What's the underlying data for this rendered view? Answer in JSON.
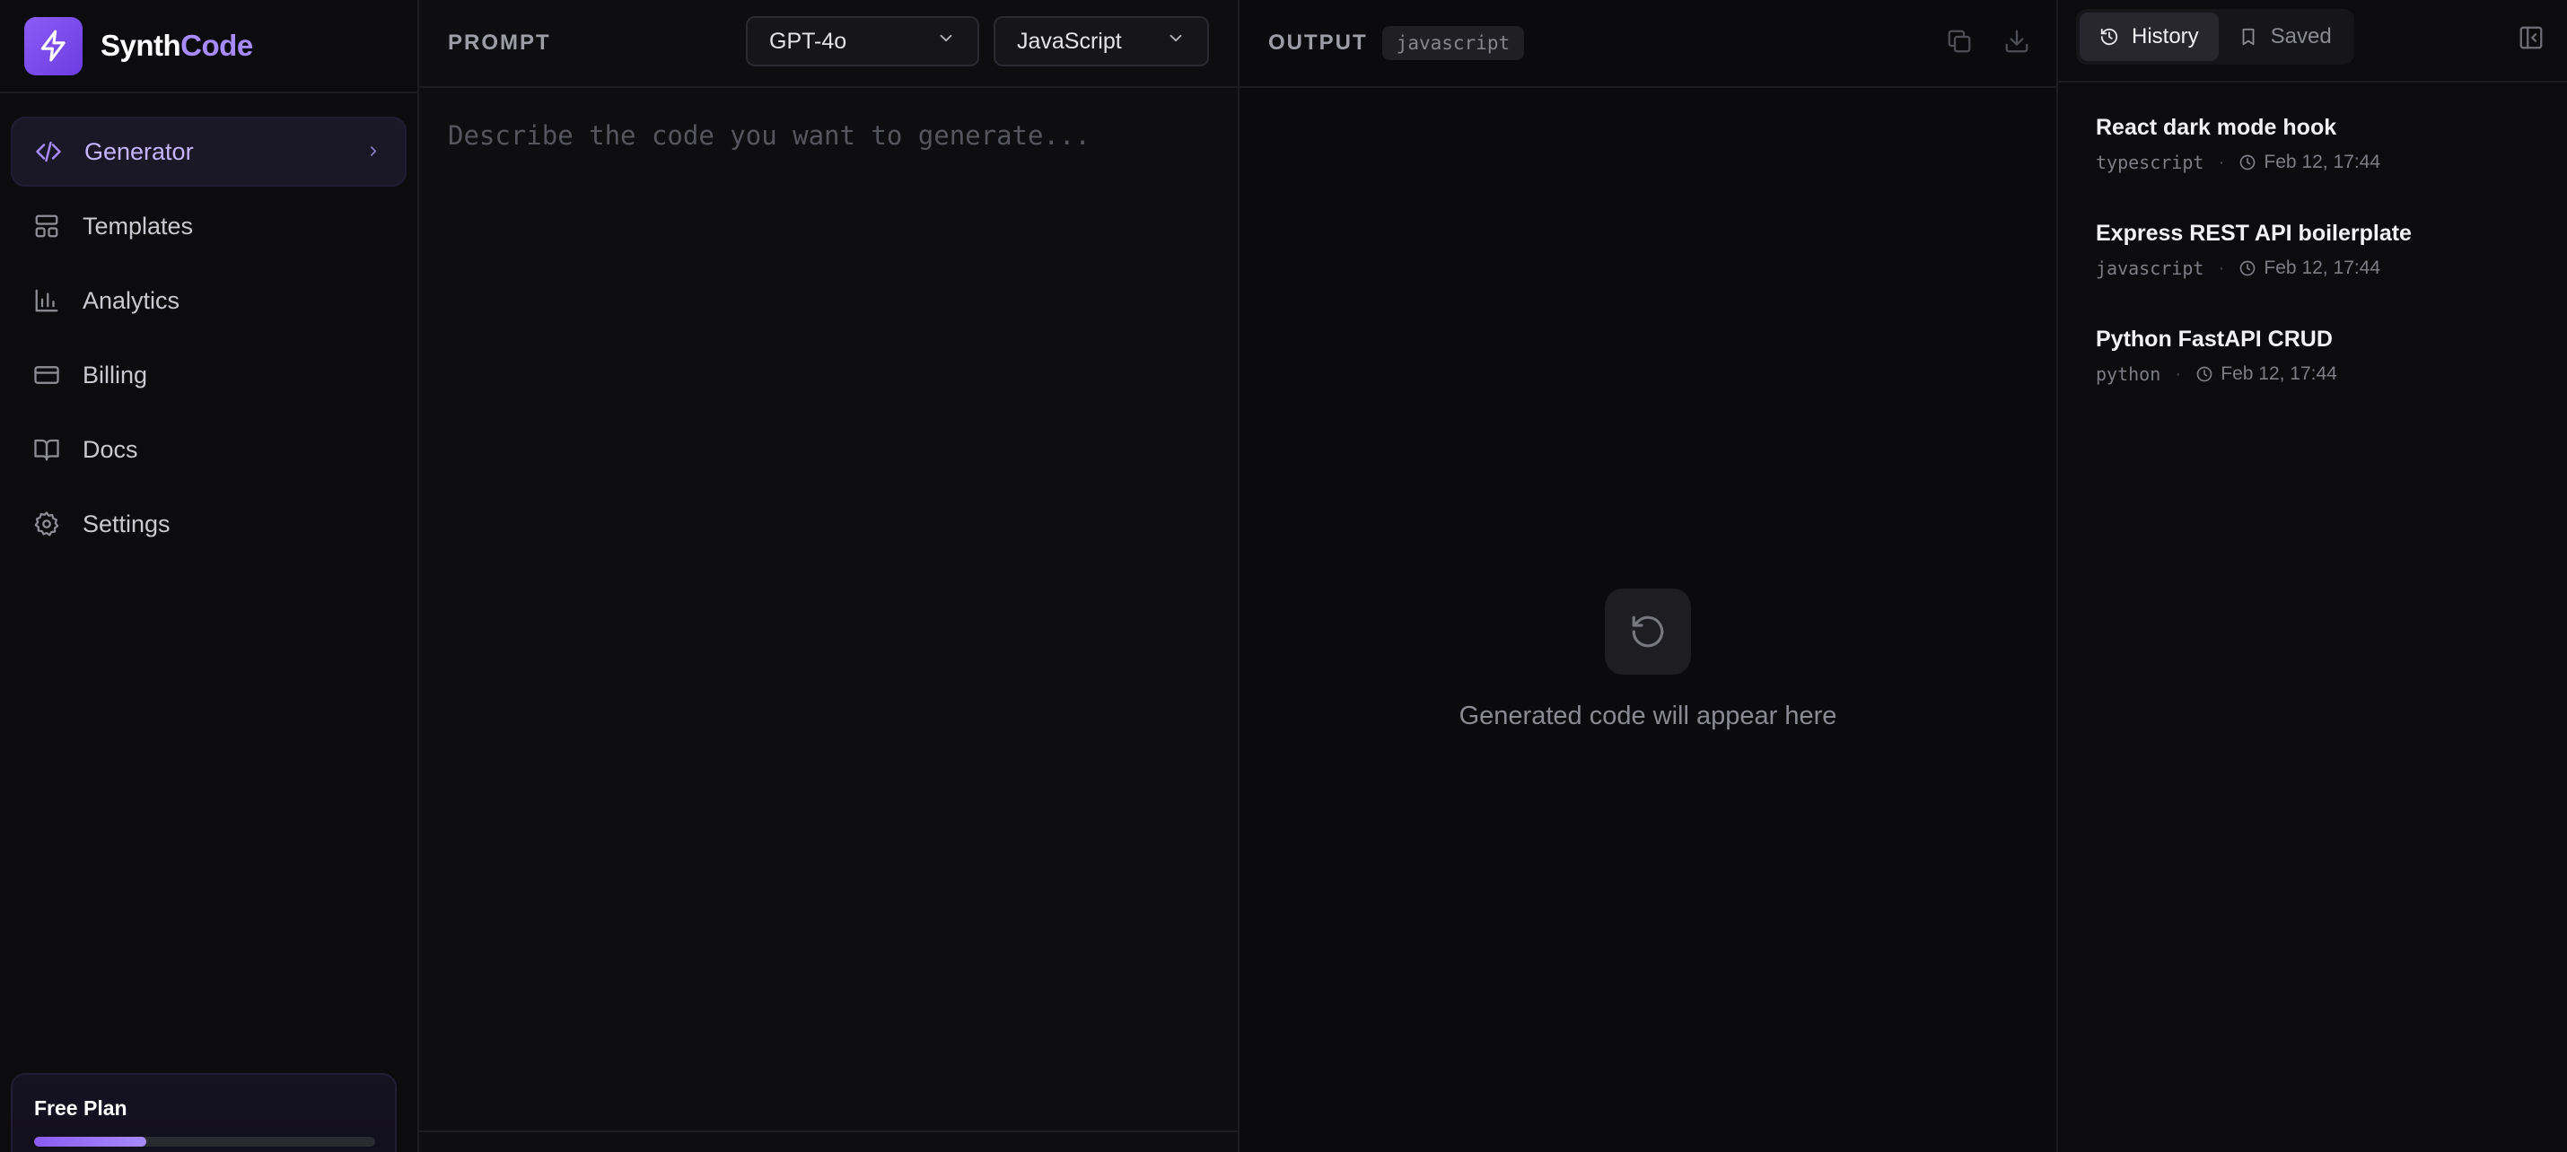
{
  "brand": {
    "name_part1": "Synth",
    "name_part2": "Code"
  },
  "sidebar": {
    "items": [
      {
        "label": "Generator",
        "icon": "code-icon",
        "active": true
      },
      {
        "label": "Templates",
        "icon": "layout-icon"
      },
      {
        "label": "Analytics",
        "icon": "bar-chart-icon"
      },
      {
        "label": "Billing",
        "icon": "credit-card-icon"
      },
      {
        "label": "Docs",
        "icon": "book-icon"
      },
      {
        "label": "Settings",
        "icon": "gear-icon"
      }
    ],
    "plan": {
      "title": "Free Plan",
      "usage_fraction": 0.33
    }
  },
  "prompt": {
    "label": "PROMPT",
    "model_select": "GPT-4o",
    "language_select": "JavaScript",
    "placeholder": "Describe the code you want to generate..."
  },
  "output": {
    "label": "OUTPUT",
    "language_badge": "javascript",
    "empty_text": "Generated code will appear here"
  },
  "history": {
    "tabs": [
      {
        "label": "History",
        "icon": "history-icon",
        "active": true
      },
      {
        "label": "Saved",
        "icon": "bookmark-icon"
      }
    ],
    "items": [
      {
        "title": "React dark mode hook",
        "lang": "typescript",
        "time": "Feb 12, 17:44"
      },
      {
        "title": "Express REST API boilerplate",
        "lang": "javascript",
        "time": "Feb 12, 17:44"
      },
      {
        "title": "Python FastAPI CRUD",
        "lang": "python",
        "time": "Feb 12, 17:44"
      }
    ]
  },
  "colors": {
    "accent": "#8b5cf6",
    "accent_light": "#a78bfa",
    "background": "#0b0b0e"
  }
}
